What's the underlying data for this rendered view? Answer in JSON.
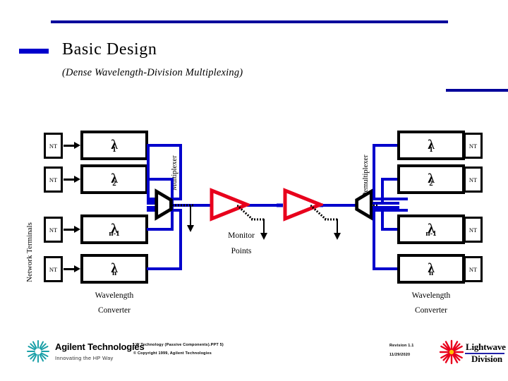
{
  "slide": {
    "title": "Basic Design",
    "subtitle": "(Dense Wavelength-Division Multiplexing)"
  },
  "diagram": {
    "left_label": "Network Terminals",
    "mux_label": "Multiplexer",
    "demux_label": "Demultiplexer",
    "monitor_label_line1": "Monitor",
    "monitor_label_line2": "Points",
    "converter_label_line1": "Wavelength",
    "converter_label_line2": "Converter",
    "nt_label": "NT",
    "channels": [
      {
        "lambda": "λ",
        "sub": "1"
      },
      {
        "lambda": "λ",
        "sub": "2"
      },
      {
        "lambda": "λ",
        "sub": "n-1"
      },
      {
        "lambda": "λ",
        "sub": "n"
      }
    ]
  },
  "colors": {
    "rule_blue": "#00009B",
    "line_blue": "#0000CC",
    "amp_red": "#E8001C",
    "box_black": "#000000"
  },
  "footer": {
    "center_line1": "LW Technology (Passive Components).PPT   5)",
    "center_line2": "© Copyright 1999, Agilent Technologies",
    "revision": "Revision 1.1",
    "date": "11/29/2020",
    "agilent_name": "Agilent Technologies",
    "agilent_tagline": "Innovating the HP Way",
    "lightwave_line1": "Lightwave",
    "lightwave_line2": "Division"
  }
}
